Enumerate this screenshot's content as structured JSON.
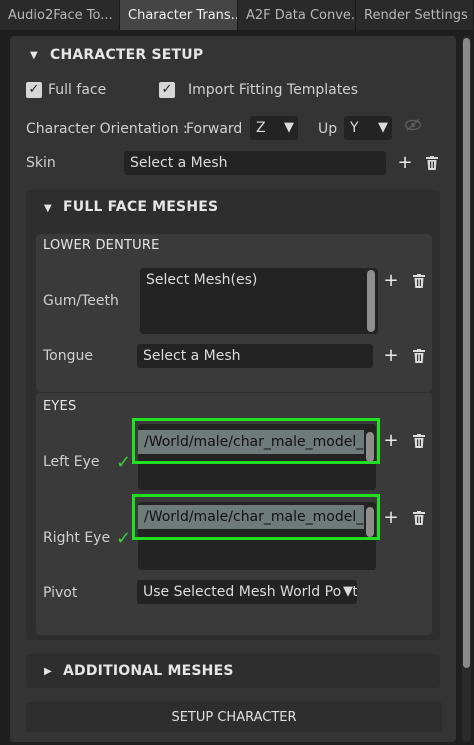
{
  "tabs": [
    "Audio2Face To...",
    "Character Trans...",
    "A2F Data Conve...",
    "Render Settings"
  ],
  "character_setup": {
    "title": "CHARACTER SETUP",
    "full_face_label": "Full face",
    "import_label": "Import Fitting Templates",
    "orientation_label": "Character Orientation :",
    "forward_label": "Forward",
    "forward_value": "Z",
    "up_label": "Up",
    "up_value": "Y",
    "skin_label": "Skin",
    "skin_value": "Select a Mesh"
  },
  "full_face_meshes": {
    "title": "FULL FACE MESHES",
    "lower_denture": {
      "title": "LOWER DENTURE",
      "gum_label": "Gum/Teeth",
      "gum_value": "Select Mesh(es)",
      "tongue_label": "Tongue",
      "tongue_value": "Select a Mesh"
    },
    "eyes": {
      "title": "EYES",
      "left_label": "Left Eye",
      "left_value": "/World/male/char_male_model_hi/l",
      "right_label": "Right Eye",
      "right_value": "/World/male/char_male_model_hi/r",
      "pivot_label": "Pivot",
      "pivot_value": "Use Selected Mesh World Posit"
    }
  },
  "additional_meshes": {
    "title": "ADDITIONAL MESHES"
  },
  "setup_button": "SETUP CHARACTER"
}
